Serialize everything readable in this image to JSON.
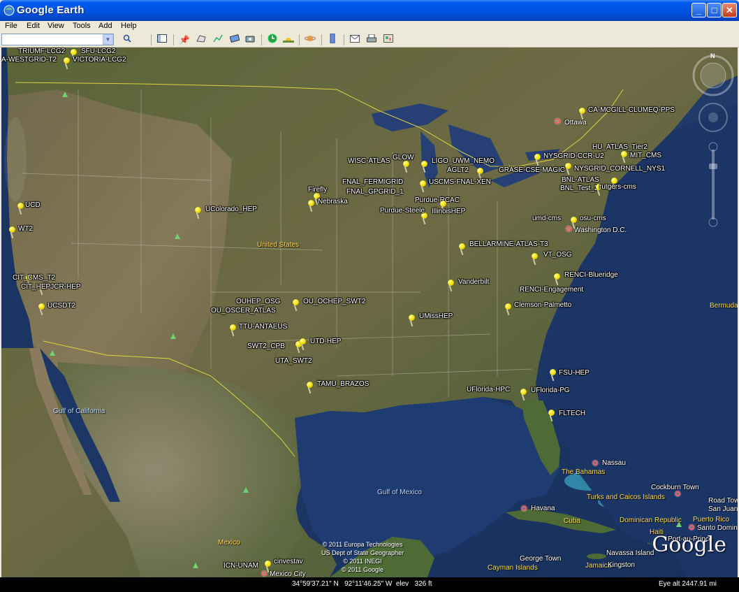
{
  "window": {
    "title": "Google Earth",
    "controls": {
      "minimize": "_",
      "maximize": "□",
      "close": "✕"
    }
  },
  "menu": [
    "File",
    "Edit",
    "View",
    "Tools",
    "Add",
    "Help"
  ],
  "toolbar": {
    "search_value": "",
    "buttons": [
      "sidebar-toggle",
      "placemark",
      "polygon",
      "path",
      "image-overlay",
      "record-tour",
      "historical-imagery",
      "sun",
      "planets",
      "ruler",
      "email",
      "print",
      "view-in-maps"
    ]
  },
  "map": {
    "sites": [
      {
        "name": "TRIUMF-LCG2"
      },
      {
        "name": "SFU-LCG2"
      },
      {
        "name": "A-WESTGRID-T2"
      },
      {
        "name": "VICTORIA-LCG2"
      },
      {
        "name": "UCD"
      },
      {
        "name": "WT2"
      },
      {
        "name": "CIT_CMS_T2"
      },
      {
        "name": "CIT_HEPJCR-HEP"
      },
      {
        "name": "UCSDT2"
      },
      {
        "name": "UColorado_HEP"
      },
      {
        "name": "Firefly"
      },
      {
        "name": "Nebraska"
      },
      {
        "name": "OUHEP_OSG"
      },
      {
        "name": "OU_OCHEP_SWT2"
      },
      {
        "name": "OU_OSCER_ATLAS"
      },
      {
        "name": "TTU-ANTAEUS"
      },
      {
        "name": "SWT2_CPB"
      },
      {
        "name": "UTD-HEP"
      },
      {
        "name": "UTA_SWT2"
      },
      {
        "name": "TAMU_BRAZOS"
      },
      {
        "name": "WISC-ATLAS"
      },
      {
        "name": "GLOW"
      },
      {
        "name": "LIGO_UWM_NEMO"
      },
      {
        "name": "AGLT2"
      },
      {
        "name": "FNAL_FERMIGRID"
      },
      {
        "name": "USCMS-FNAL-XEN"
      },
      {
        "name": "FNAL_GPGRID_1"
      },
      {
        "name": "Purdue-RCAC"
      },
      {
        "name": "Purdue-Steele"
      },
      {
        "name": "IllinoisHEP"
      },
      {
        "name": "CA-MCGILL-CLUMEQ-PPS"
      },
      {
        "name": "HU_ATLAS_Tier2"
      },
      {
        "name": "NYSGRID-CCR-U2"
      },
      {
        "name": "MIT_CMS"
      },
      {
        "name": "GRASE-CSE-MAGIC"
      },
      {
        "name": "NYSGRID_CORNELL_NYS1"
      },
      {
        "name": "BNL-ATLAS"
      },
      {
        "name": "BNL_Test_2"
      },
      {
        "name": "rutgers-cms"
      },
      {
        "name": "umd-cms"
      },
      {
        "name": "osu-cms"
      },
      {
        "name": "BELLARMINE-ATLAS-T3"
      },
      {
        "name": "VT_OSG"
      },
      {
        "name": "RENCI-Blueridge"
      },
      {
        "name": "RENCI-Engagement"
      },
      {
        "name": "Vanderbilt"
      },
      {
        "name": "Clemson-Palmetto"
      },
      {
        "name": "UMissHEP"
      },
      {
        "name": "FSU-HEP"
      },
      {
        "name": "UFlorida-HPC"
      },
      {
        "name": "UFlorida-PG"
      },
      {
        "name": "FLTECH"
      },
      {
        "name": "ICN-UNAM"
      },
      {
        "name": "cinvestav"
      }
    ],
    "cities": [
      "Ottawa",
      "Washington D.C.",
      "Nassau",
      "Havana",
      "Cockburn Town",
      "Road Tow",
      "San Juan",
      "Santo Domin",
      "Port-au-Prince",
      "Navassa Island",
      "George Town",
      "Kingston",
      "Mexico City"
    ],
    "regions": {
      "united_states": "United States",
      "mexico": "Mexico",
      "cuba": "Cuba",
      "bahamas": "The Bahamas",
      "turks_caicos": "Turks and Caicos Islands",
      "dominican_republic": "Dominican Republic",
      "puerto_rico": "Puerto Rico",
      "haiti": "Haiti",
      "cayman": "Cayman Islands",
      "jamaica": "Jamaica",
      "bermuda": "Bermuda"
    },
    "water": {
      "gulf_mexico": "Gulf of Mexico",
      "gulf_california": "Gulf of California"
    },
    "credits": "© 2011 Europa Technologies\nUS Dept of State Geographer\n© 2011 INEGI\n© 2011 Google",
    "logo": "Google"
  },
  "status": {
    "coords": "34°59'37.21\" N   92°11'46.25\" W  elev   326 ft",
    "eye_alt": "Eye alt  2447.91 mi"
  },
  "colors": {
    "titlebar": "#0054e3",
    "pin": "#f2de00",
    "ocean": "#1d3660",
    "border": "#e8e040"
  }
}
